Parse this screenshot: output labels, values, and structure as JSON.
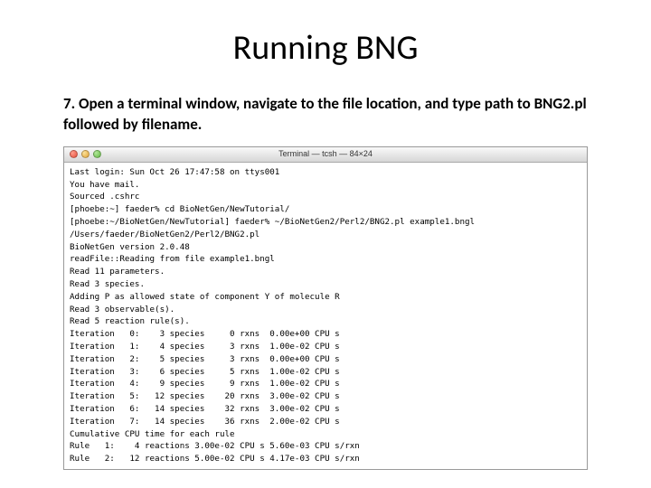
{
  "title": "Running BNG",
  "instruction": "7. Open a terminal window, navigate to the file location, and type path to BNG2.pl followed by filename.",
  "terminal": {
    "window_title": "Terminal — tcsh — 84×24",
    "lines": [
      "Last login: Sun Oct 26 17:47:58 on ttys001",
      "You have mail.",
      "Sourced .cshrc",
      "[phoebe:~] faeder% cd BioNetGen/NewTutorial/",
      "[phoebe:~/BioNetGen/NewTutorial] faeder% ~/BioNetGen2/Perl2/BNG2.pl example1.bngl",
      "/Users/faeder/BioNetGen2/Perl2/BNG2.pl",
      "BioNetGen version 2.0.48",
      "readFile::Reading from file example1.bngl",
      "Read 11 parameters.",
      "Read 3 species.",
      "Adding P as allowed state of component Y of molecule R",
      "Read 3 observable(s).",
      "Read 5 reaction rule(s).",
      "Iteration   0:    3 species     0 rxns  0.00e+00 CPU s",
      "Iteration   1:    4 species     3 rxns  1.00e-02 CPU s",
      "Iteration   2:    5 species     3 rxns  0.00e+00 CPU s",
      "Iteration   3:    6 species     5 rxns  1.00e-02 CPU s",
      "Iteration   4:    9 species     9 rxns  1.00e-02 CPU s",
      "Iteration   5:   12 species    20 rxns  3.00e-02 CPU s",
      "Iteration   6:   14 species    32 rxns  3.00e-02 CPU s",
      "Iteration   7:   14 species    36 rxns  2.00e-02 CPU s",
      "Cumulative CPU time for each rule",
      "Rule   1:    4 reactions 3.00e-02 CPU s 5.60e-03 CPU s/rxn",
      "Rule   2:   12 reactions 5.00e-02 CPU s 4.17e-03 CPU s/rxn"
    ]
  }
}
